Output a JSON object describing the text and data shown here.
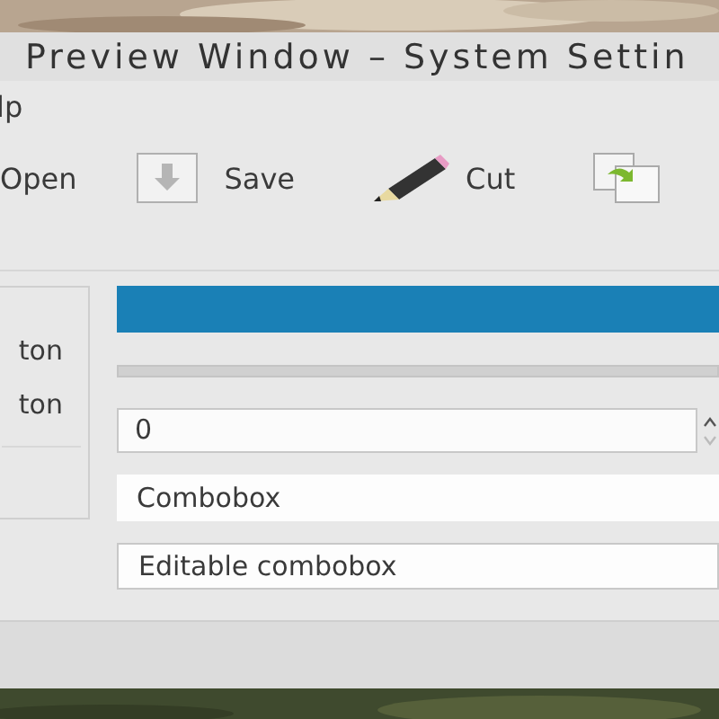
{
  "window": {
    "title": "Preview Window – System Settin"
  },
  "menu": [
    "lp"
  ],
  "toolbar": [
    {
      "kind": "text",
      "label": "Open"
    },
    {
      "kind": "save",
      "label": "Save"
    },
    {
      "kind": "cut",
      "label": "Cut"
    },
    {
      "kind": "paste"
    }
  ],
  "group": {
    "items": [
      "ton",
      "ton"
    ]
  },
  "progress": {
    "level": 1
  },
  "spinbox": {
    "value": "0"
  },
  "combobox": {
    "value": "Combobox"
  },
  "editable_combobox": {
    "value": "Editable combobox"
  }
}
